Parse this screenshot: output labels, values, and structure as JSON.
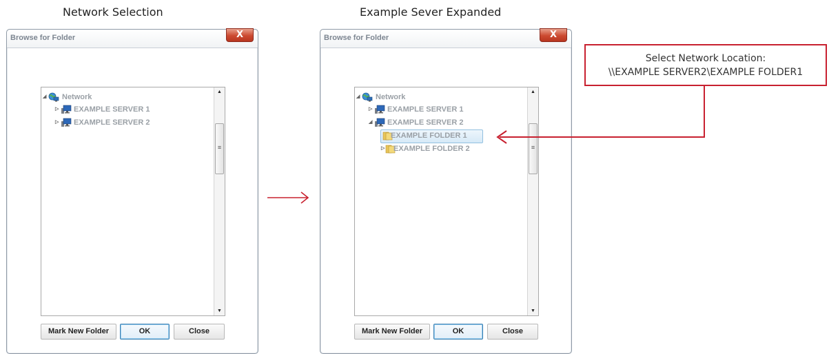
{
  "captions": {
    "left": "Network Selection",
    "right": "Example Sever Expanded"
  },
  "dialog": {
    "title": "Browse for Folder",
    "close_glyph": "X",
    "buttons": {
      "new_folder": "Mark New Folder",
      "ok": "OK",
      "close": "Close"
    },
    "scroll_grip": "≡"
  },
  "left_tree": {
    "root": "Network",
    "items": [
      "EXAMPLE SERVER 1",
      "EXAMPLE SERVER 2"
    ]
  },
  "right_tree": {
    "root": "Network",
    "servers": [
      "EXAMPLE SERVER 1",
      "EXAMPLE SERVER 2"
    ],
    "folders": [
      "EXAMPLE FOLDER 1",
      "EXAMPLE FOLDER 2"
    ],
    "selected": "EXAMPLE FOLDER 1"
  },
  "callout": {
    "line1": "Select Network Location:",
    "line2": "\\\\EXAMPLE SERVER2\\EXAMPLE FOLDER1"
  },
  "colors": {
    "accent_red": "#c8202f",
    "selection_border": "#92c0e0"
  },
  "icons": {
    "network": "network-globe-icon",
    "server": "server-computer-icon",
    "folder": "folder-icon"
  }
}
